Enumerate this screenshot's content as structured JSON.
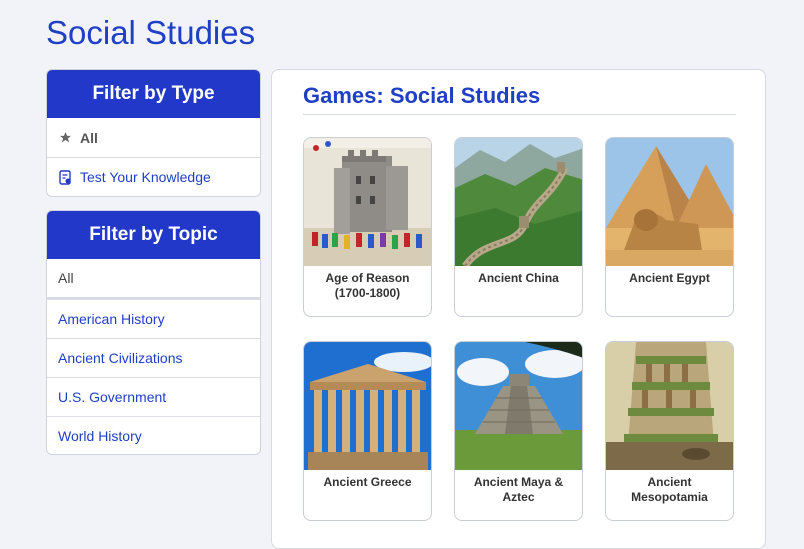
{
  "page": {
    "title": "Social Studies"
  },
  "filter_type": {
    "header": "Filter by Type",
    "items": [
      {
        "label": "All",
        "icon": "star-icon"
      },
      {
        "label": "Test Your Knowledge",
        "icon": "quiz-document-icon"
      }
    ]
  },
  "filter_topic": {
    "header": "Filter by Topic",
    "items": [
      {
        "label": "All"
      },
      {
        "label": "American History"
      },
      {
        "label": "Ancient Civilizations"
      },
      {
        "label": "U.S. Government"
      },
      {
        "label": "World History"
      }
    ]
  },
  "main": {
    "title": "Games: Social Studies",
    "cards": [
      {
        "label": "Age of Reason (1700-1800)"
      },
      {
        "label": "Ancient China"
      },
      {
        "label": "Ancient Egypt"
      },
      {
        "label": "Ancient Greece"
      },
      {
        "label": "Ancient Maya & Aztec"
      },
      {
        "label": "Ancient Mesopotamia"
      }
    ]
  },
  "colors": {
    "accent": "#2238c8",
    "link": "#1f3fc4",
    "background": "#f1f3f9"
  }
}
